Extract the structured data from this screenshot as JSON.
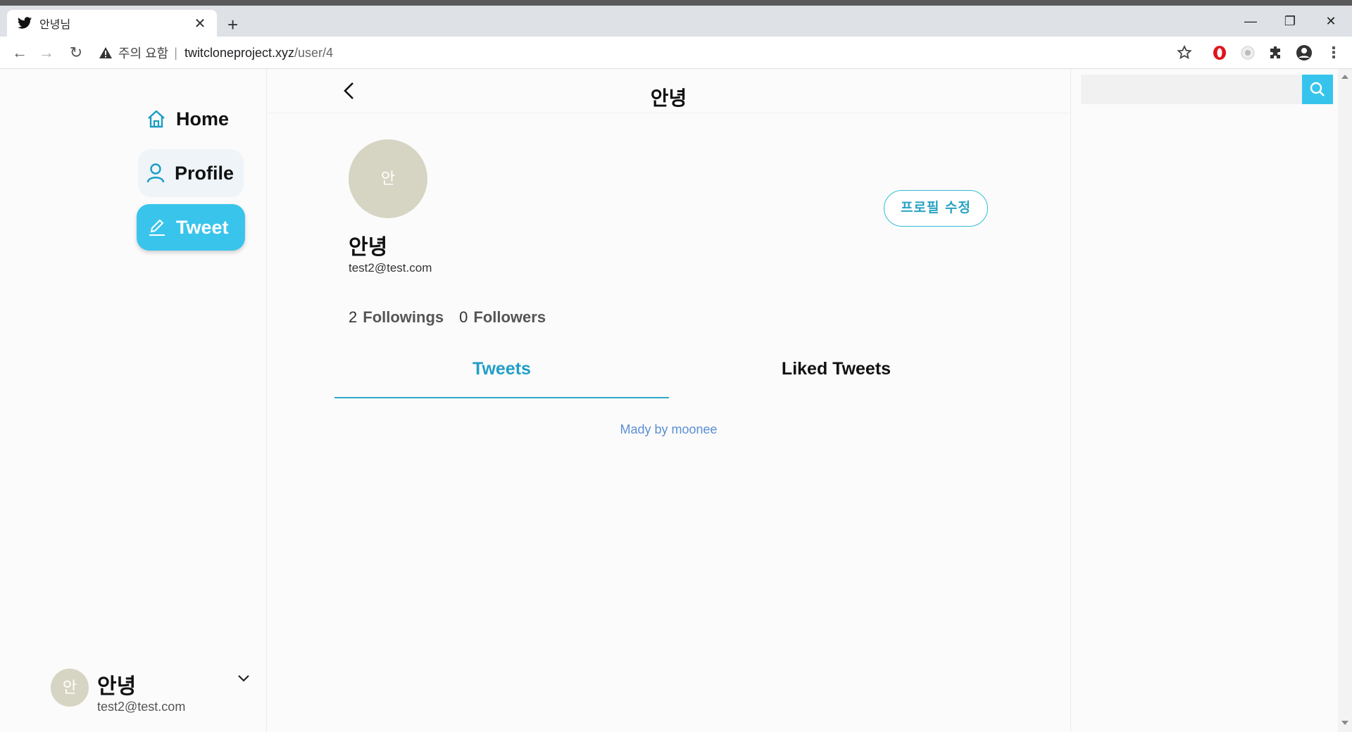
{
  "browser": {
    "tab_title": "안녕님",
    "new_tab": "+",
    "address": {
      "security_label": "주의 요함",
      "separator": "|",
      "host": "twitcloneproject.xyz",
      "path": "/user/4"
    }
  },
  "sidebar": {
    "items": [
      {
        "label": "Home",
        "icon": "home-icon"
      },
      {
        "label": "Profile",
        "icon": "user-icon"
      },
      {
        "label": "Tweet",
        "icon": "pen-icon"
      }
    ],
    "user": {
      "avatar_initial": "안",
      "name": "안녕",
      "email": "test2@test.com"
    }
  },
  "main": {
    "header_title": "안녕",
    "profile": {
      "avatar_initial": "안",
      "name": "안녕",
      "email": "test2@test.com",
      "edit_button": "프로필 수정",
      "followings_count": "2",
      "followings_label": "Followings",
      "followers_count": "0",
      "followers_label": "Followers"
    },
    "tabs": [
      {
        "label": "Tweets",
        "active": true
      },
      {
        "label": "Liked Tweets",
        "active": false
      }
    ],
    "footer": "Mady by moonee"
  },
  "colors": {
    "accent": "#39c4ec",
    "tab_active": "#229ec7",
    "avatar_bg": "#d6d5c3",
    "footer_link": "#5b8fd4"
  }
}
